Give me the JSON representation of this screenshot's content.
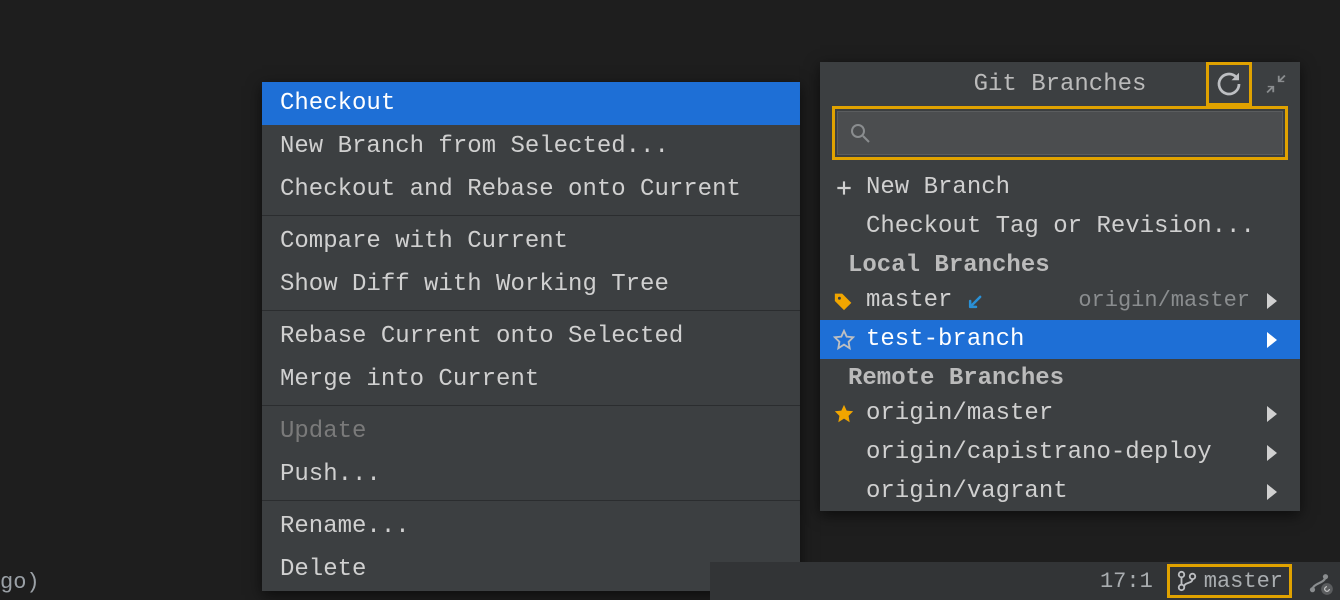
{
  "editor": {
    "behind_text": "go)"
  },
  "context_menu": {
    "items": [
      {
        "label": "Checkout",
        "state": "selected"
      },
      {
        "label": "New Branch from Selected...",
        "state": "normal"
      },
      {
        "label": "Checkout and Rebase onto Current",
        "state": "normal"
      },
      {
        "sep": true
      },
      {
        "label": "Compare with Current",
        "state": "normal"
      },
      {
        "label": "Show Diff with Working Tree",
        "state": "normal"
      },
      {
        "sep": true
      },
      {
        "label": "Rebase Current onto Selected",
        "state": "normal"
      },
      {
        "label": "Merge into Current",
        "state": "normal"
      },
      {
        "sep": true
      },
      {
        "label": "Update",
        "state": "disabled"
      },
      {
        "label": "Push...",
        "state": "normal"
      },
      {
        "sep": true
      },
      {
        "label": "Rename...",
        "state": "normal"
      },
      {
        "label": "Delete",
        "state": "normal"
      }
    ]
  },
  "branches_popup": {
    "title": "Git Branches",
    "search_placeholder": "",
    "new_branch": "New Branch",
    "checkout_tag": "Checkout Tag or Revision...",
    "local_header": "Local Branches",
    "remote_header": "Remote Branches",
    "local": [
      {
        "name": "master",
        "tracking": "origin/master",
        "icon": "tag",
        "incoming": true
      },
      {
        "name": "test-branch",
        "icon": "star-outline",
        "selected": true
      }
    ],
    "remote": [
      {
        "name": "origin/master",
        "icon": "star-filled"
      },
      {
        "name": "origin/capistrano-deploy"
      },
      {
        "name": "origin/vagrant"
      }
    ]
  },
  "status_bar": {
    "line_col": "17:1",
    "current_branch": "master"
  }
}
